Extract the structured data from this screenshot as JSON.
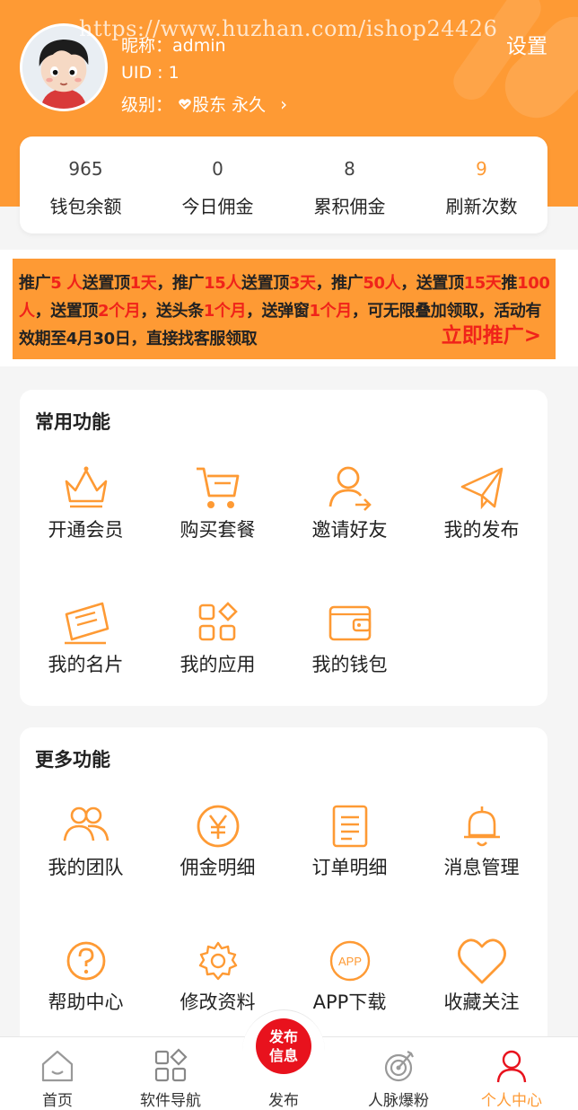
{
  "watermark": "https://www.huzhan.com/ishop24426",
  "profile": {
    "nickname_label": "昵称：",
    "nickname": "admin",
    "uid_text": "UID : 1",
    "level_label": "级别：",
    "level_value": "股东 永久",
    "level_chevron": "›",
    "settings_label": "设置"
  },
  "stats": [
    {
      "value": "965",
      "label": "钱包余额"
    },
    {
      "value": "0",
      "label": "今日佣金"
    },
    {
      "value": "8",
      "label": "累积佣金"
    },
    {
      "value": "9",
      "label": "刷新次数"
    }
  ],
  "promo": {
    "segments": [
      {
        "t": "推广",
        "red": false
      },
      {
        "t": "5 人",
        "red": true
      },
      {
        "t": "送置顶",
        "red": false
      },
      {
        "t": "1天",
        "red": true
      },
      {
        "t": "，推广",
        "red": false
      },
      {
        "t": "15人",
        "red": true
      },
      {
        "t": "送置顶",
        "red": false
      },
      {
        "t": "3天",
        "red": true
      },
      {
        "t": "，推广",
        "red": false
      },
      {
        "t": "50人",
        "red": true
      },
      {
        "t": "，送置顶",
        "red": false
      },
      {
        "t": "15天",
        "red": true
      },
      {
        "t": "推",
        "red": false
      },
      {
        "t": "100人",
        "red": true
      },
      {
        "t": "，送置顶",
        "red": false
      },
      {
        "t": "2个月",
        "red": true
      },
      {
        "t": "，送头条",
        "red": false
      },
      {
        "t": "1个月",
        "red": true
      },
      {
        "t": "，送弹窗",
        "red": false
      },
      {
        "t": "1个月",
        "red": true
      },
      {
        "t": "，可无限叠加领取，活动有效期至4月30日，直接找客服领取",
        "red": false
      }
    ],
    "cta": "立即推广>"
  },
  "common": {
    "title": "常用功能",
    "items": [
      {
        "label": "开通会员",
        "icon": "crown-icon"
      },
      {
        "label": "购买套餐",
        "icon": "cart-icon"
      },
      {
        "label": "邀请好友",
        "icon": "invite-user-icon"
      },
      {
        "label": "我的发布",
        "icon": "paper-plane-icon"
      },
      {
        "label": "我的名片",
        "icon": "business-card-icon"
      },
      {
        "label": "我的应用",
        "icon": "apps-grid-icon"
      },
      {
        "label": "我的钱包",
        "icon": "wallet-icon"
      }
    ]
  },
  "more": {
    "title": "更多功能",
    "items": [
      {
        "label": "我的团队",
        "icon": "team-icon"
      },
      {
        "label": "佣金明细",
        "icon": "yen-coin-icon"
      },
      {
        "label": "订单明细",
        "icon": "order-list-icon"
      },
      {
        "label": "消息管理",
        "icon": "bell-icon"
      },
      {
        "label": "帮助中心",
        "icon": "help-icon"
      },
      {
        "label": "修改资料",
        "icon": "gear-icon"
      },
      {
        "label": "APP下载",
        "icon": "app-download-icon",
        "icon_text": "APP"
      },
      {
        "label": "收藏关注",
        "icon": "heart-icon"
      }
    ]
  },
  "tabbar": {
    "publish_button": "发布\n信息",
    "tabs": [
      {
        "label": "首页",
        "icon": "home-icon"
      },
      {
        "label": "软件导航",
        "icon": "nav-grid-icon"
      },
      {
        "label": "发布",
        "icon": "publish-icon"
      },
      {
        "label": "人脉爆粉",
        "icon": "target-icon"
      },
      {
        "label": "个人中心",
        "icon": "user-icon",
        "active": true
      }
    ]
  },
  "colors": {
    "brand": "#fe9a34",
    "promo_red": "#f0231a",
    "publish_red": "#e8121d"
  }
}
